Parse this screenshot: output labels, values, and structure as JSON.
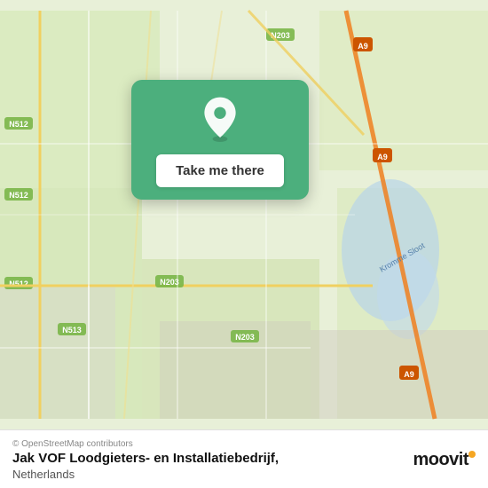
{
  "map": {
    "alt": "OpenStreetMap of Netherlands area"
  },
  "card": {
    "button_label": "Take me there"
  },
  "info_bar": {
    "copyright": "© OpenStreetMap contributors",
    "business_name": "Jak VOF Loodgieters- en Installatiebedrijf,",
    "country": "Netherlands",
    "moovit_label": "moovit"
  },
  "colors": {
    "card_bg": "#4caf7d",
    "moovit_dot": "#f5a623"
  }
}
